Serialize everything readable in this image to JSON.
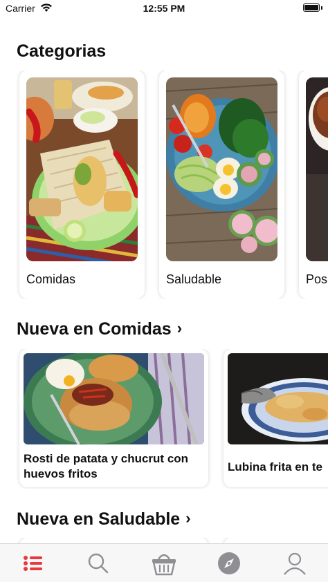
{
  "status_bar": {
    "carrier": "Carrier",
    "time": "12:55 PM"
  },
  "categories": {
    "title": "Categorias",
    "items": [
      {
        "label": "Comidas",
        "image": "mexican-tamales-plate"
      },
      {
        "label": "Saludable",
        "image": "healthy-salad-bowl"
      },
      {
        "label": "Pos",
        "image": "chocolate-dessert"
      }
    ]
  },
  "section_comidas": {
    "title": "Nueva en Comidas",
    "chevron": "›",
    "items": [
      {
        "title": "Rosti de patata y chucrut con huevos fritos",
        "image": "rosti-potato-eggs"
      },
      {
        "title": "Lubina frita en te",
        "image": "fried-sea-bass"
      }
    ]
  },
  "section_saludable": {
    "title": "Nueva en Saludable",
    "chevron": "›"
  },
  "tab_bar": {
    "active_color": "#e8383d",
    "inactive_color": "#8e8e93",
    "tabs": [
      {
        "icon": "list-icon",
        "active": true
      },
      {
        "icon": "search-icon",
        "active": false
      },
      {
        "icon": "basket-icon",
        "active": false
      },
      {
        "icon": "compass-icon",
        "active": false
      },
      {
        "icon": "profile-icon",
        "active": false
      }
    ]
  }
}
